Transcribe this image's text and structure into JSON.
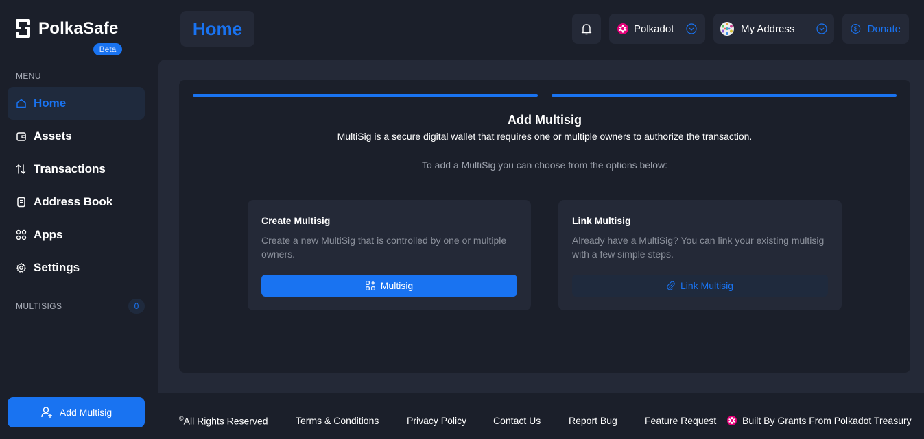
{
  "brand": {
    "name": "PolkaSafe",
    "badge": "Beta"
  },
  "sidebar": {
    "menu_label": "MENU",
    "items": [
      {
        "label": "Home",
        "icon": "home-icon",
        "active": true
      },
      {
        "label": "Assets",
        "icon": "wallet-icon"
      },
      {
        "label": "Transactions",
        "icon": "transfer-arrows-icon"
      },
      {
        "label": "Address Book",
        "icon": "address-book-icon"
      },
      {
        "label": "Apps",
        "icon": "apps-grid-icon"
      },
      {
        "label": "Settings",
        "icon": "gear-icon"
      }
    ],
    "multisigs_label": "MULTISIGS",
    "multisigs_count": "0",
    "add_button": "Add Multisig"
  },
  "header": {
    "title": "Home",
    "network": "Polkadot",
    "address": "My Address",
    "donate": "Donate"
  },
  "main": {
    "title": "Add Multisig",
    "description": "MultiSig is a secure digital wallet that requires one or multiple owners to authorize the transaction.",
    "hint": "To add a MultiSig you can choose from the options below:",
    "options": [
      {
        "title": "Create Multisig",
        "text": "Create a new MultiSig that is controlled by one or multiple owners.",
        "button": "Multisig"
      },
      {
        "title": "Link Multisig",
        "text": "Already have a MultiSig? You can link your existing multisig with a few simple steps.",
        "button": "Link Multisig"
      }
    ]
  },
  "footer": {
    "copyright_symbol": "©",
    "rights": "All Rights Reserved",
    "terms": "Terms & Conditions",
    "privacy": "Privacy Policy",
    "contact": "Contact Us",
    "report": "Report Bug",
    "feature": "Feature Request",
    "built_by": "Built By Grants From Polkadot Treasury"
  },
  "colors": {
    "background": "#1b1f2a",
    "panel": "#242937",
    "accent": "#1973f1",
    "polkadot_pink": "#e6007a"
  }
}
